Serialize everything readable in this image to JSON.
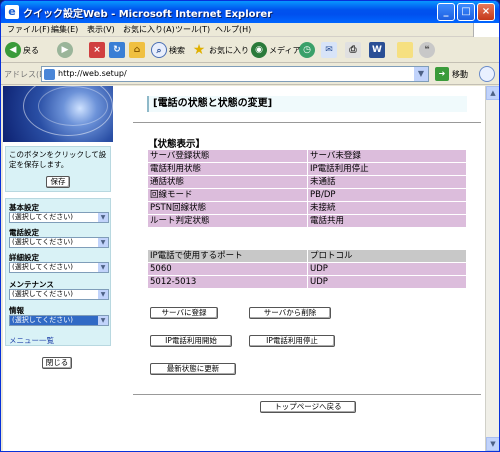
{
  "window": {
    "title": "クイック設定Web - Microsoft Internet Explorer",
    "minimize_label": "_",
    "maximize_label": "□",
    "close_label": "×"
  },
  "menubar": {
    "items": [
      "ファイル(F)",
      "編集(E)",
      "表示(V)",
      "お気に入り(A)",
      "ツール(T)",
      "ヘルプ(H)"
    ]
  },
  "toolbar": {
    "back": "戻る",
    "search": "検索",
    "favorites": "お気に入り",
    "media": "メディア"
  },
  "address": {
    "label": "アドレス(D)",
    "url": "http://web.setup/",
    "go": "移動"
  },
  "sidebar": {
    "save_hint": "このボタンをクリックして設定を保存します。",
    "save_button": "保存",
    "nav": [
      {
        "header": "基本設定",
        "select": "(選択してください)"
      },
      {
        "header": "電話設定",
        "select": "(選択してください)"
      },
      {
        "header": "詳細設定",
        "select": "(選択してください)"
      },
      {
        "header": "メンテナンス",
        "select": "(選択してください)"
      },
      {
        "header": "情報",
        "select": "(選択してください)"
      }
    ],
    "menu_list": "メニュー一覧",
    "close_button": "閉じる"
  },
  "main": {
    "page_title": "[電話の状態と状態の変更]",
    "status_section": "【状態表示】",
    "status_rows": [
      {
        "label": "サーバ登録状態",
        "value": "サーバ未登録"
      },
      {
        "label": "電話利用状態",
        "value": "IP電話利用停止"
      },
      {
        "label": "通話状態",
        "value": "未通話"
      },
      {
        "label": "回線モード",
        "value": "PB/DP"
      },
      {
        "label": "PSTN回線状態",
        "value": "未接続"
      },
      {
        "label": "ルート判定状態",
        "value": "電話共用"
      }
    ],
    "port_table": {
      "headers": [
        "IP電話で使用するポート",
        "プロトコル"
      ],
      "rows": [
        {
          "port": "5060",
          "protocol": "UDP"
        },
        {
          "port": "5012-5013",
          "protocol": "UDP"
        }
      ]
    },
    "buttons": {
      "register": "サーバに登録",
      "unregister": "サーバから削除",
      "start": "IP電話利用開始",
      "stop": "IP電話利用停止",
      "refresh": "最新状態に更新",
      "top": "トップページへ戻る"
    }
  }
}
